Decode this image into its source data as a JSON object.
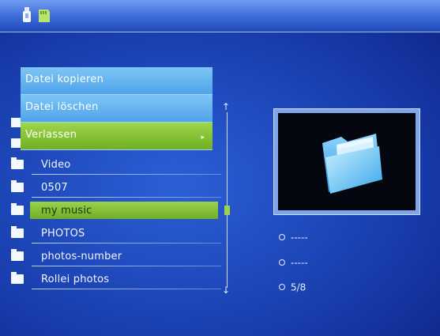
{
  "topbar": {
    "icons": [
      "usb-icon",
      "memory-card-icon"
    ]
  },
  "context_menu": {
    "items": [
      {
        "label": "Datei kopieren"
      },
      {
        "label": "Datei löschen"
      },
      {
        "label": "Verlassen",
        "has_submenu_arrow": true,
        "arrow": "▸"
      }
    ],
    "active_index": 2
  },
  "file_list": {
    "items": [
      {
        "label": "Video"
      },
      {
        "label": "0507"
      },
      {
        "label": "my music"
      },
      {
        "label": "PHOTOS"
      },
      {
        "label": "photos-number"
      },
      {
        "label": "Rollei photos"
      }
    ],
    "selected_index": 2,
    "icon": "folder-icon"
  },
  "scrollbar": {
    "up_arrow": "↑",
    "down_arrow": "↓"
  },
  "preview": {
    "icon": "folder-icon"
  },
  "info": {
    "line1": "-----",
    "line2": "-----",
    "position": "5/8"
  },
  "colors": {
    "background": "#1d46b8",
    "menu_blue": "#5fb0ee",
    "highlight_green": "#8ccb3e"
  }
}
